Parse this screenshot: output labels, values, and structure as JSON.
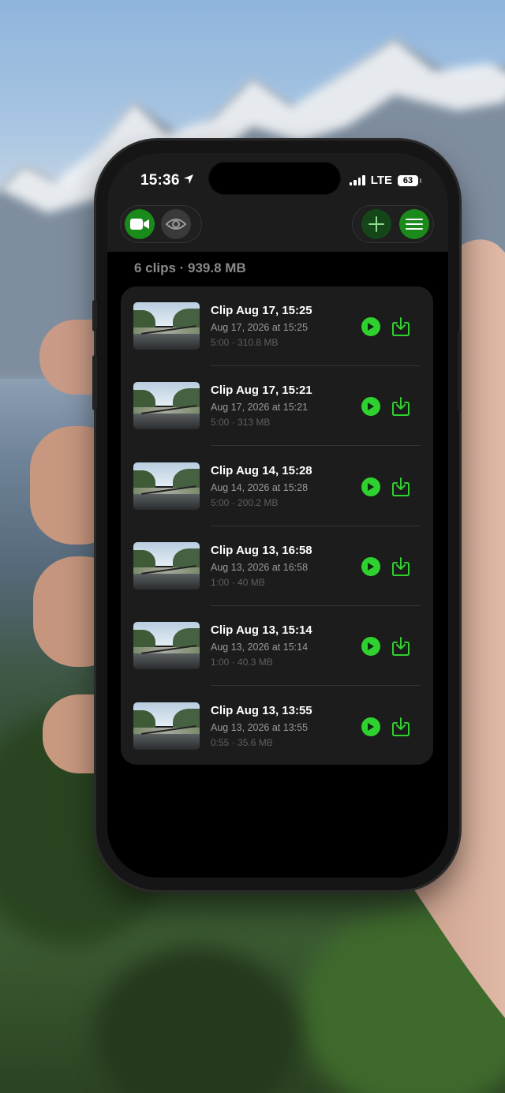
{
  "status_bar": {
    "time": "15:36",
    "network": "LTE",
    "battery": "63"
  },
  "toolbar": {
    "left": [
      {
        "icon": "video-camera-icon",
        "active": true
      },
      {
        "icon": "eye-icon",
        "active": false
      }
    ],
    "right": [
      {
        "icon": "plus-icon"
      },
      {
        "icon": "menu-icon"
      }
    ]
  },
  "summary": "6 clips · 939.8 MB",
  "clips": [
    {
      "title": "Clip Aug 17, 15:25",
      "date": "Aug 17, 2026 at 15:25",
      "meta": "5:00 · 310.8 MB"
    },
    {
      "title": "Clip Aug 17, 15:21",
      "date": "Aug 17, 2026 at 15:21",
      "meta": "5:00 · 313 MB"
    },
    {
      "title": "Clip Aug 14, 15:28",
      "date": "Aug 14, 2026 at 15:28",
      "meta": "5:00 · 200.2 MB"
    },
    {
      "title": "Clip Aug 13, 16:58",
      "date": "Aug 13, 2026 at 16:58",
      "meta": "1:00 · 40 MB"
    },
    {
      "title": "Clip Aug 13, 15:14",
      "date": "Aug 13, 2026 at 15:14",
      "meta": "1:00 · 40.3 MB"
    },
    {
      "title": "Clip Aug 13, 13:55",
      "date": "Aug 13, 2026 at 13:55",
      "meta": "0:55 · 35.6 MB"
    }
  ],
  "colors": {
    "accent": "#2ed12e",
    "accent_dark": "#1a8a1a",
    "background": "#000000",
    "card": "#1c1c1c"
  }
}
